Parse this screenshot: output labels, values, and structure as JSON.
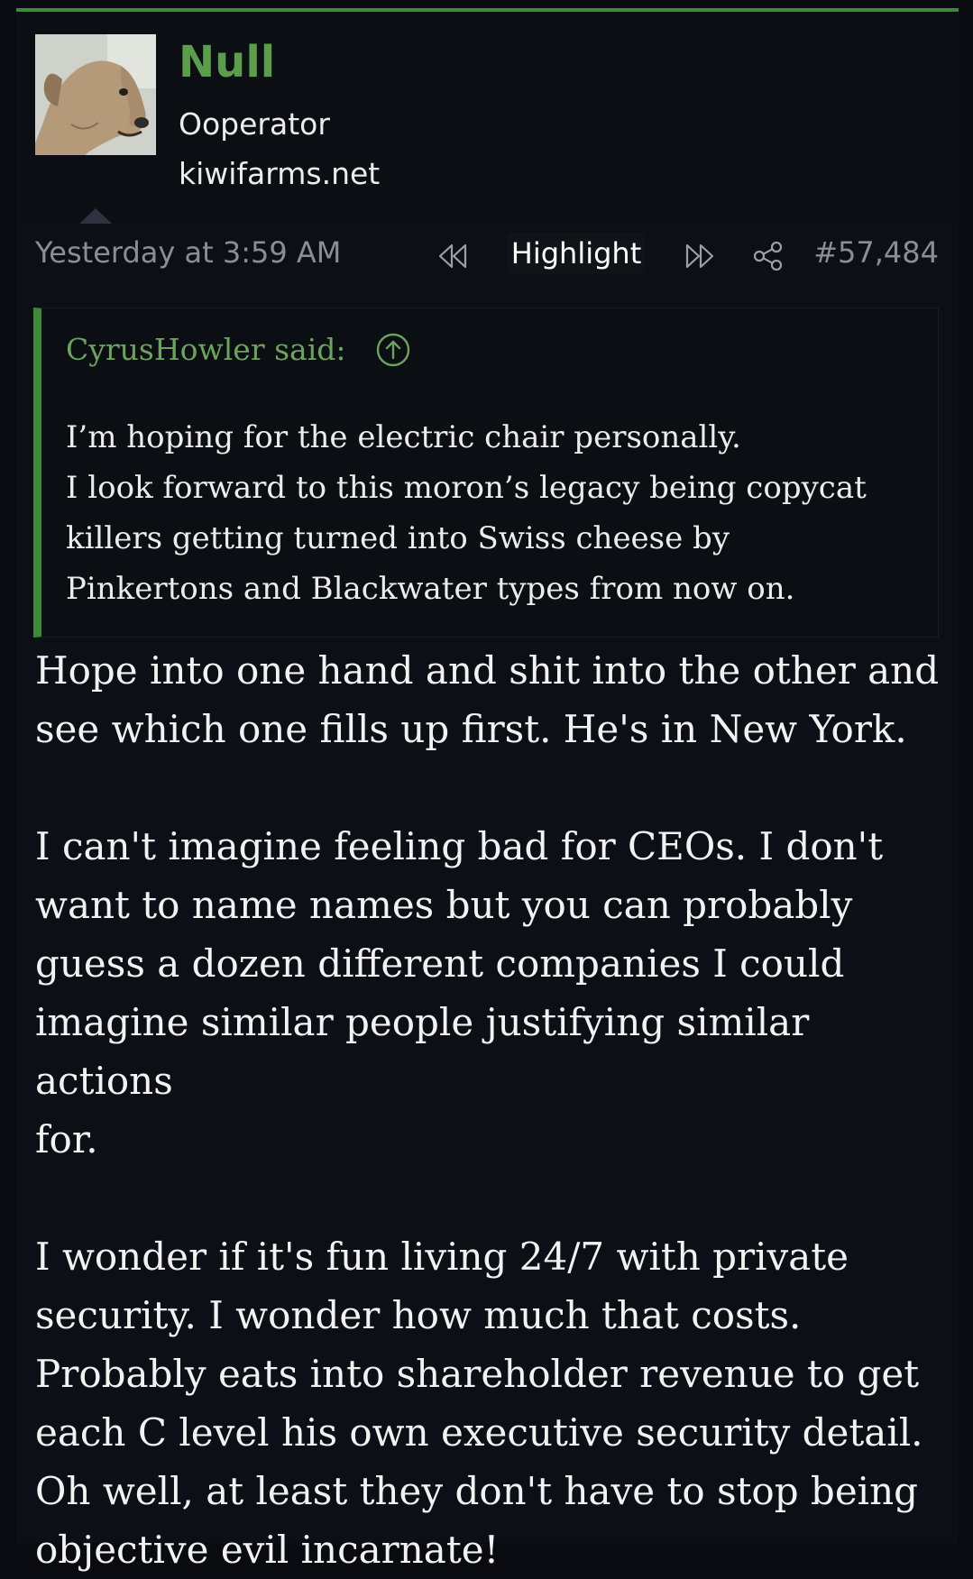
{
  "user": {
    "name": "Null",
    "title": "Ooperator",
    "banner": "kiwifarms.net"
  },
  "post_meta": {
    "timestamp": "Yesterday at 3:59 AM",
    "highlight_label": "Highlight",
    "post_number": "#57,484"
  },
  "icons": {
    "prev": "rewind-icon",
    "next": "fast-forward-icon",
    "share": "share-icon",
    "jump_to_quote": "arrow-up-circle-icon"
  },
  "quote": {
    "author_said": "CyrusHowler said:",
    "lines": "I’m hoping for the electric chair personally.\nI look forward to this moron’s legacy being copycat\nkillers getting turned into Swiss cheese by\nPinkertons and Blackwater types from now on."
  },
  "body": {
    "paragraphs": [
      "Hope into one hand and shit into the other and\nsee which one fills up first. He's in New York.",
      "I can't imagine feeling bad for CEOs. I don't\nwant to name names but you can probably\nguess a dozen different companies I could\nimagine similar people justifying similar actions\nfor.",
      "I wonder if it's fun living 24/7 with private\nsecurity. I wonder how much that costs.\nProbably eats into shareholder revenue to get\neach C level his own executive security detail.\nOh well, at least they don't have to stop being\nobjective evil incarnate!"
    ]
  },
  "colors": {
    "accent_green": "#3d8a35",
    "username_green": "#5a9e4b",
    "background": "#090b10"
  }
}
